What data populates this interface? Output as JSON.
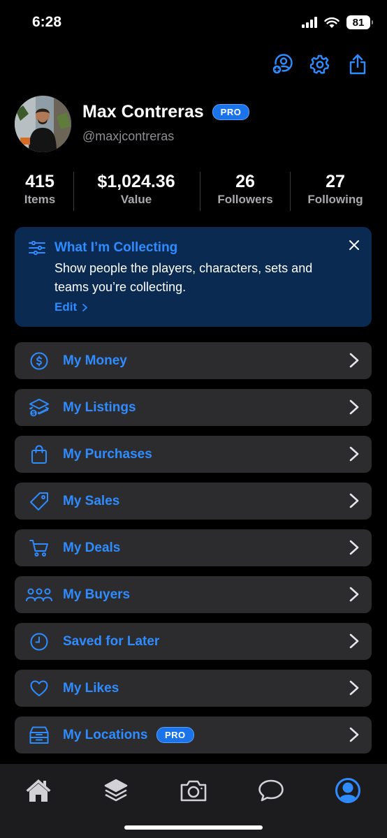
{
  "status_bar": {
    "time": "6:28",
    "battery": "81"
  },
  "top_actions": [
    "add-user-icon",
    "gear-icon",
    "share-icon"
  ],
  "profile": {
    "name": "Max Contreras",
    "badge": "PRO",
    "handle": "@maxjcontreras"
  },
  "stats": [
    {
      "value": "415",
      "label": "Items"
    },
    {
      "value": "$1,024.36",
      "label": "Value"
    },
    {
      "value": "26",
      "label": "Followers"
    },
    {
      "value": "27",
      "label": "Following"
    }
  ],
  "collecting": {
    "title": "What I’m Collecting",
    "text": "Show people the players, characters, sets and teams you’re collecting.",
    "edit": "Edit"
  },
  "menu": [
    {
      "label": "My Money",
      "icon": "dollar-circle-icon"
    },
    {
      "label": "My Listings",
      "icon": "layers-dollar-icon"
    },
    {
      "label": "My Purchases",
      "icon": "shopping-bag-icon"
    },
    {
      "label": "My Sales",
      "icon": "tag-icon"
    },
    {
      "label": "My Deals",
      "icon": "cart-icon"
    },
    {
      "label": "My Buyers",
      "icon": "group-icon"
    },
    {
      "label": "Saved for Later",
      "icon": "clock-icon"
    },
    {
      "label": "My Likes",
      "icon": "heart-icon"
    },
    {
      "label": "My Locations",
      "icon": "archive-box-icon",
      "badge": "PRO"
    }
  ],
  "tabbar": [
    "home-icon",
    "layers-icon",
    "camera-icon",
    "chat-icon",
    "profile-icon"
  ],
  "colors": {
    "accent": "#2f8cff",
    "background": "#000000",
    "card": "#2c2c2e",
    "collect_card": "#0a2a52",
    "tabbar": "#1c1c1e"
  }
}
